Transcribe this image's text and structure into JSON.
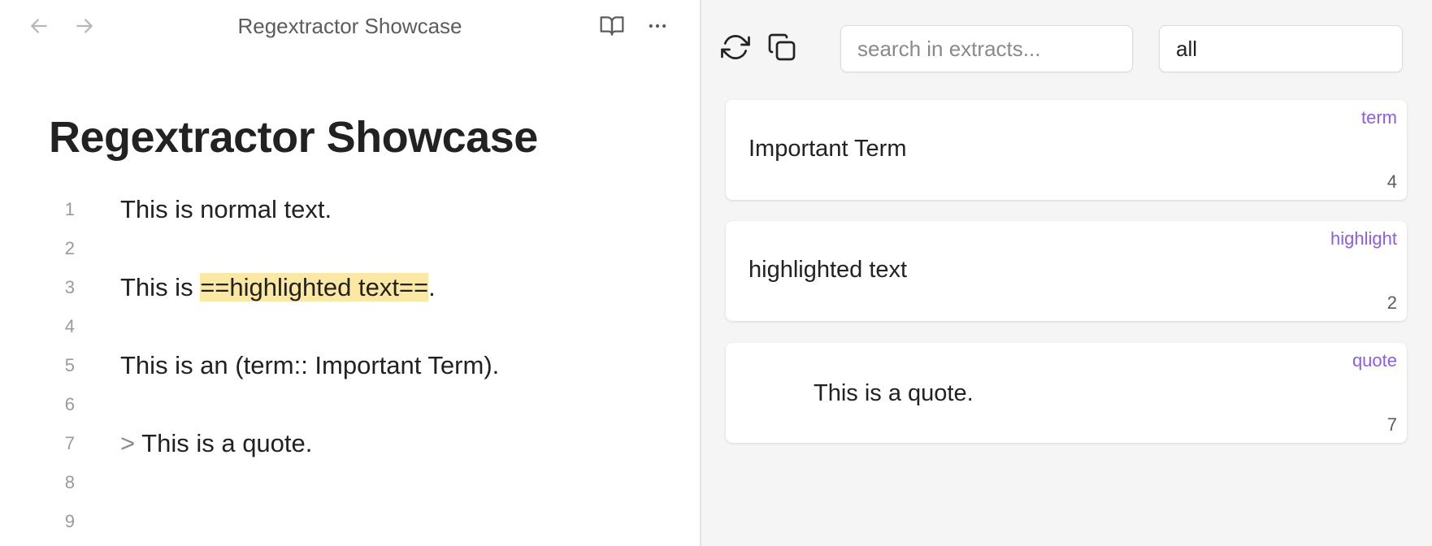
{
  "editor": {
    "view_title": "Regextractor Showcase",
    "note_title": "Regextractor Showcase",
    "icons": {
      "back": "arrow-left-icon",
      "forward": "arrow-right-icon",
      "reading": "book-open-icon",
      "more": "more-horizontal-icon"
    },
    "lines": [
      {
        "num": "1",
        "text": "This is normal text."
      },
      {
        "num": "2",
        "text": ""
      },
      {
        "num": "3",
        "prefix": "This is ",
        "highlight": "==highlighted text==",
        "suffix": "."
      },
      {
        "num": "4",
        "text": ""
      },
      {
        "num": "5",
        "text": "This is an (term:: Important Term)."
      },
      {
        "num": "6",
        "text": ""
      },
      {
        "num": "7",
        "marker": ">",
        "text": " This is a quote."
      },
      {
        "num": "8",
        "text": ""
      },
      {
        "num": "9",
        "text": ""
      }
    ]
  },
  "panel": {
    "icons": {
      "refresh": "refresh-icon",
      "copy": "copy-icon"
    },
    "search": {
      "placeholder": "search in extracts...",
      "value": ""
    },
    "filter": {
      "value": "all"
    },
    "cards": [
      {
        "tag": "term",
        "text": "Important Term",
        "line": "4"
      },
      {
        "tag": "highlight",
        "text": "highlighted text",
        "line": "2"
      },
      {
        "tag": "quote",
        "text": "This is a quote.",
        "line": "7"
      }
    ]
  },
  "colors": {
    "accent_tag": "#8a5cf5",
    "highlight": "#fbe9a3",
    "panel_bg": "#f5f5f5"
  }
}
